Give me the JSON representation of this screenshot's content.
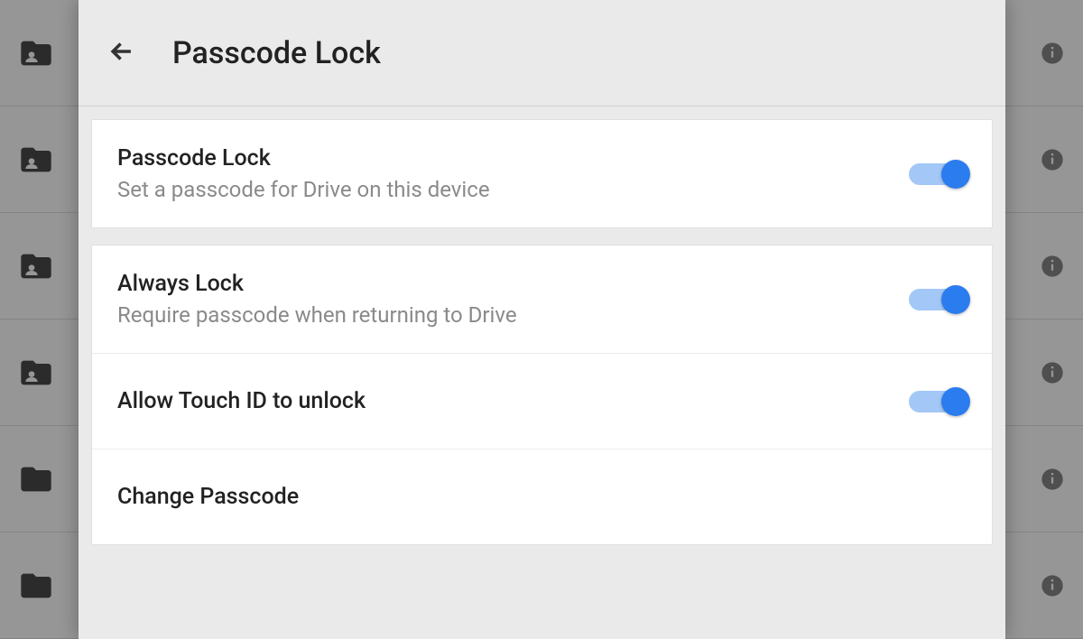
{
  "header": {
    "title": "Passcode Lock"
  },
  "sections": {
    "passcode": {
      "title": "Passcode Lock",
      "subtitle": "Set a passcode for Drive on this device",
      "enabled": true
    },
    "always_lock": {
      "title": "Always Lock",
      "subtitle": "Require passcode when returning to Drive",
      "enabled": true
    },
    "touch_id": {
      "title": "Allow Touch ID to unlock",
      "enabled": true
    },
    "change_passcode": {
      "title": "Change Passcode"
    }
  }
}
